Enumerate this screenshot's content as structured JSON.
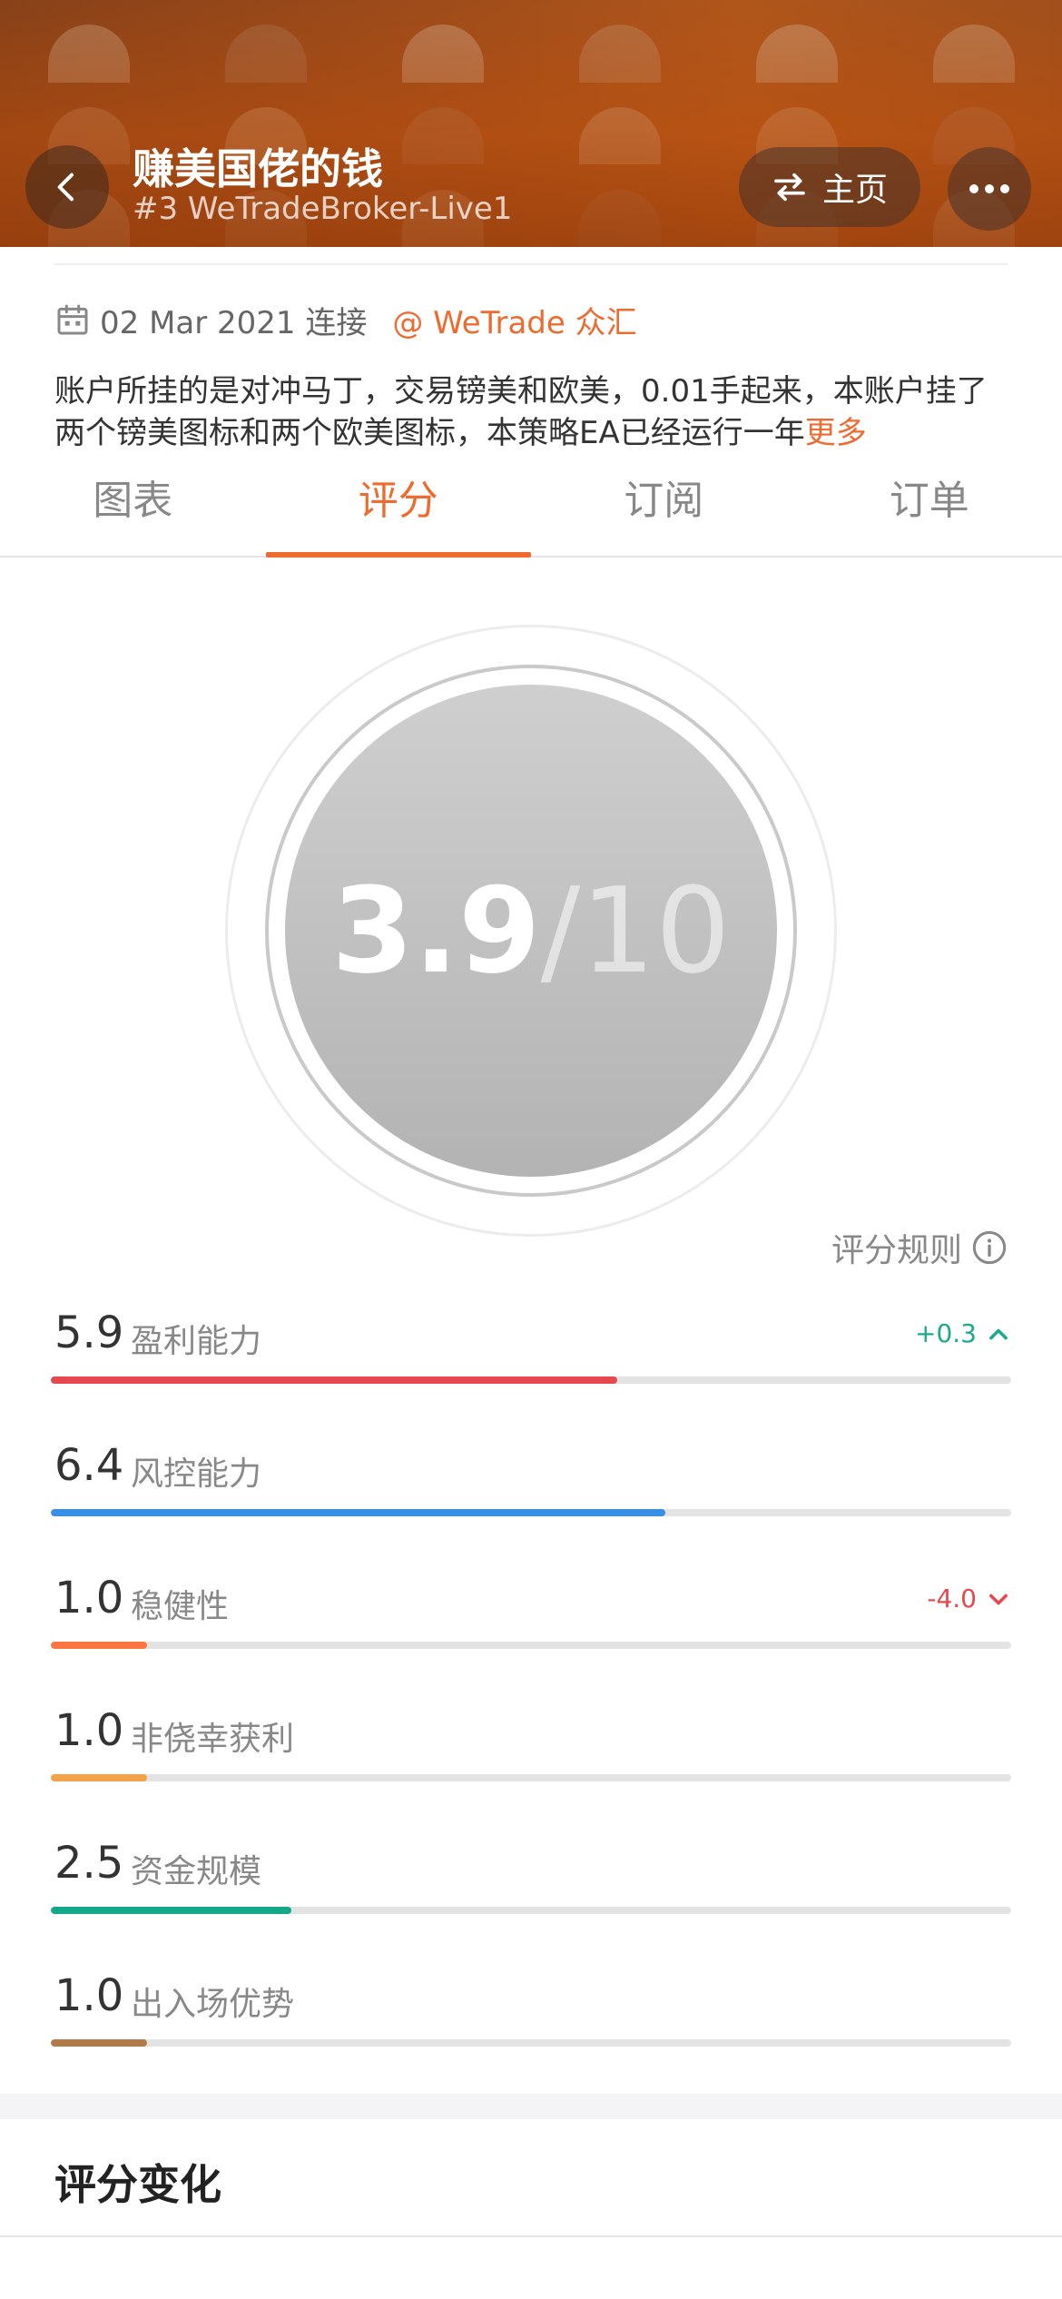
{
  "header": {
    "title": "赚美国佬的钱",
    "subtitle": "#3 WeTradeBroker-Live1",
    "home_label": "主页"
  },
  "info": {
    "date": "02 Mar 2021 连接",
    "broker": "@ WeTrade 众汇"
  },
  "description": {
    "text": "账户所挂的是对冲马丁，交易镑美和欧美，0.01手起来，本账户挂了两个镑美图标和两个欧美图标，本策略EA已经运行一年",
    "more_label": "更多"
  },
  "tabs": [
    {
      "label": "图表",
      "active": false
    },
    {
      "label": "评分",
      "active": true
    },
    {
      "label": "订阅",
      "active": false
    },
    {
      "label": "订单",
      "active": false
    }
  ],
  "score": {
    "value": "3.9",
    "max": "/10"
  },
  "rule_link": "评分规则",
  "metrics": [
    {
      "value": "5.9",
      "label": "盈利能力",
      "change": "+0.3",
      "direction": "up",
      "fraction": 0.59,
      "color": "#e5484d"
    },
    {
      "value": "6.4",
      "label": "风控能力",
      "change": "",
      "direction": "",
      "fraction": 0.64,
      "color": "#3a8ee6"
    },
    {
      "value": "1.0",
      "label": "稳健性",
      "change": "-4.0",
      "direction": "down",
      "fraction": 0.1,
      "color": "#ff7540"
    },
    {
      "value": "1.0",
      "label": "非侥幸获利",
      "change": "",
      "direction": "",
      "fraction": 0.1,
      "color": "#f2a24a"
    },
    {
      "value": "2.5",
      "label": "资金规模",
      "change": "",
      "direction": "",
      "fraction": 0.25,
      "color": "#13a887"
    },
    {
      "value": "1.0",
      "label": "出入场优势",
      "change": "",
      "direction": "",
      "fraction": 0.1,
      "color": "#b07a4a"
    }
  ],
  "section": {
    "title": "评分变化"
  },
  "colors": {
    "accent": "#ee6b2f",
    "up": "#1aaa8d",
    "down": "#e5484d"
  }
}
